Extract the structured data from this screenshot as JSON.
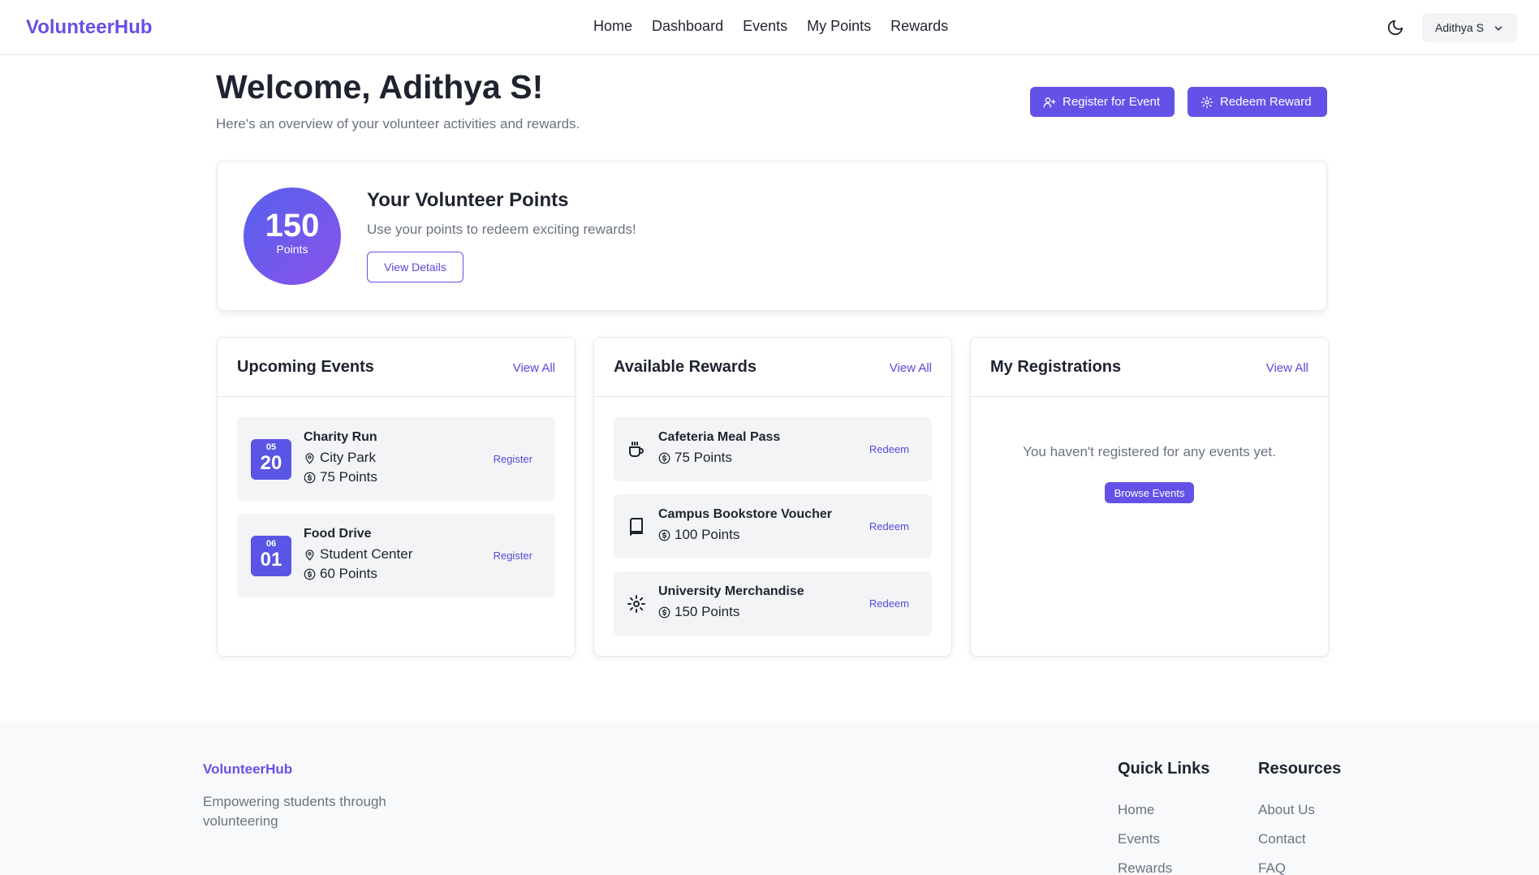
{
  "header": {
    "brand": "VolunteerHub",
    "nav": [
      "Home",
      "Dashboard",
      "Events",
      "My Points",
      "Rewards"
    ],
    "theme_icon": "moon-icon",
    "user_name": "Adithya S"
  },
  "welcome": {
    "title": "Welcome, Adithya S!",
    "subtitle": "Here's an overview of your volunteer activities and rewards.",
    "register_label": "Register for Event",
    "redeem_label": "Redeem Reward"
  },
  "points": {
    "value": "150",
    "unit": "Points",
    "title": "Your Volunteer Points",
    "subtitle": "Use your points to redeem exciting rewards!",
    "details_label": "View Details"
  },
  "upcoming_events": {
    "title": "Upcoming Events",
    "view_all": "View All",
    "items": [
      {
        "month": "05",
        "day": "20",
        "name": "Charity Run",
        "location": "City Park",
        "points": "75 Points",
        "action": "Register"
      },
      {
        "month": "06",
        "day": "01",
        "name": "Food Drive",
        "location": "Student Center",
        "points": "60 Points",
        "action": "Register"
      }
    ]
  },
  "available_rewards": {
    "title": "Available Rewards",
    "view_all": "View All",
    "items": [
      {
        "icon": "coffee-icon",
        "name": "Cafeteria Meal Pass",
        "points": "75 Points",
        "action": "Redeem"
      },
      {
        "icon": "book-icon",
        "name": "Campus Bookstore Voucher",
        "points": "100 Points",
        "action": "Redeem"
      },
      {
        "icon": "sparkle-icon",
        "name": "University Merchandise",
        "points": "150 Points",
        "action": "Redeem"
      }
    ]
  },
  "my_registrations": {
    "title": "My Registrations",
    "view_all": "View All",
    "empty_text": "You haven't registered for any events yet.",
    "browse_label": "Browse Events"
  },
  "footer": {
    "brand": "VolunteerHub",
    "tagline": "Empowering students through volunteering",
    "quick_links_title": "Quick Links",
    "quick_links": [
      "Home",
      "Events",
      "Rewards"
    ],
    "resources_title": "Resources",
    "resources": [
      "About Us",
      "Contact",
      "FAQ"
    ]
  },
  "colors": {
    "brand": "#6a4fe6",
    "primary": "#6452e8",
    "muted_text": "#6b7280",
    "card_bg": "#f3f4f6"
  }
}
